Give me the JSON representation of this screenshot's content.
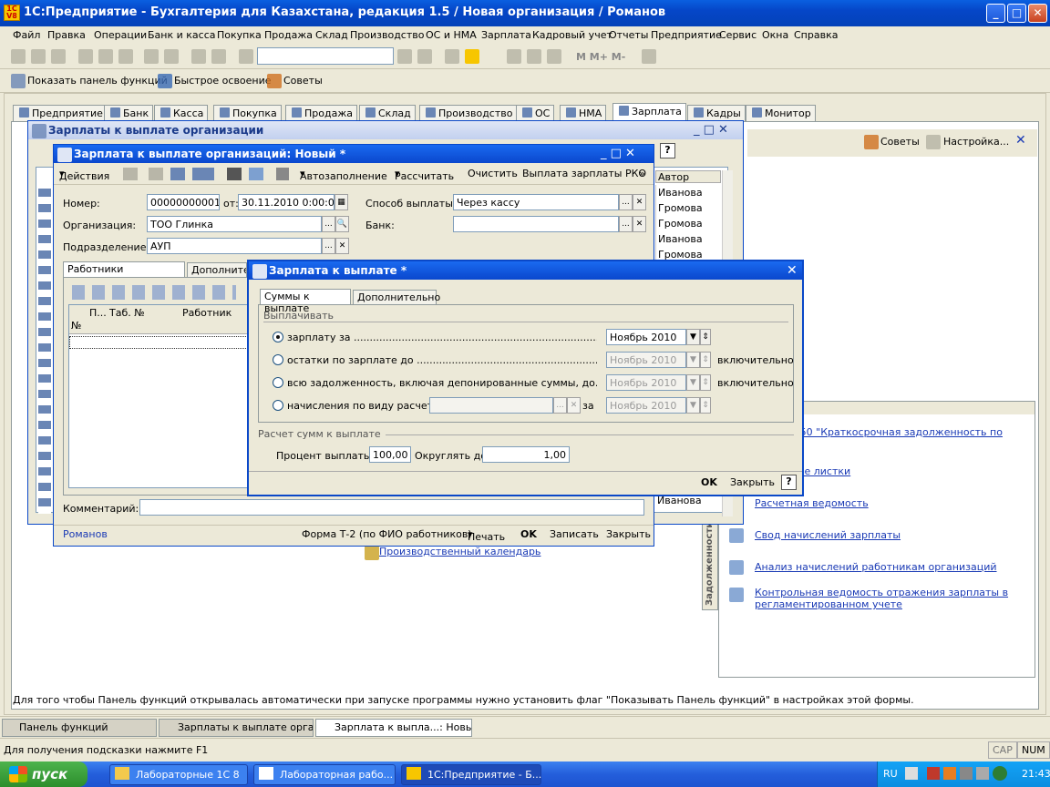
{
  "app": {
    "title": "1С:Предприятие - Бухгалтерия для Казахстана, редакция 1.5 / Новая организация / Романов",
    "logo": "1C V8"
  },
  "menu": [
    "Файл",
    "Правка",
    "Операции",
    "Банк и касса",
    "Покупка",
    "Продажа",
    "Склад",
    "Производство",
    "ОС и НМА",
    "Зарплата",
    "Кадровый учет",
    "Отчеты",
    "Предприятие",
    "Сервис",
    "Окна",
    "Справка"
  ],
  "toolbar2": {
    "show_panel": "Показать панель функций",
    "quick": "Быстрое освоение",
    "tips": "Советы"
  },
  "function_tabs": [
    "Предприятие",
    "Банк",
    "Касса",
    "Покупка",
    "Продажа",
    "Склад",
    "Производство",
    "ОС",
    "НМА",
    "Зарплата",
    "Кадры",
    "Монитор"
  ],
  "panel_right": {
    "tips": "Советы",
    "settings": "Настройка...",
    "side_label": "Задолженности"
  },
  "reports": [
    {
      "label": "...ету 3350 \"Краткосрочная задолженность по ...да\""
    },
    {
      "label": "...е листки"
    },
    {
      "label": "Расчетная ведомость"
    },
    {
      "label": "Свод начислений зарплаты"
    },
    {
      "label": "Анализ начислений работникам организаций"
    },
    {
      "label": "Контрольная ведомость отражения зарплаты в регламентированном учете"
    }
  ],
  "calendar_link": "Производственный календарь",
  "list_window": {
    "title": "Зарплаты к выплате организации",
    "col_author": "Автор",
    "authors": [
      "Иванова",
      "Громова",
      "Громова",
      "Иванова",
      "Громова"
    ],
    "bottom_author": "Иванова"
  },
  "doc_window": {
    "title": "Зарплата к выплате организаций: Новый *",
    "toolbar": {
      "actions": "Действия",
      "autofill": "Автозаполнение",
      "calculate": "Рассчитать",
      "clear": "Очистить",
      "payout": "Выплата зарплаты РКО"
    },
    "number_label": "Номер:",
    "number": "00000000001",
    "date_label": "от:",
    "date": "30.11.2010  0:00:00",
    "org_label": "Организация:",
    "org": "ТОО Глинка",
    "dept_label": "Подразделение:",
    "dept": "АУП",
    "pay_method_label": "Способ выплаты:",
    "pay_method": "Через кассу",
    "bank_label": "Банк:",
    "bank": "",
    "tabs": [
      "Работники организации",
      "Дополнител"
    ],
    "grid_cols": [
      "П...",
      "Таб. №",
      "Работник"
    ],
    "grid_col_n": "№",
    "comment_label": "Комментарий:",
    "comment": "",
    "footer": {
      "user": "Романов",
      "form": "Форма Т-2 (по ФИО работников)",
      "print": "Печать",
      "ok": "OK",
      "save": "Записать",
      "close": "Закрыть"
    }
  },
  "dialog": {
    "title": "Зарплата к выплате *",
    "tabs": [
      "Суммы к выплате",
      "Дополнительно"
    ],
    "group1": "Выплачивать",
    "options": [
      {
        "label": "зарплату за",
        "period": "Ноябрь 2010",
        "suffix": "",
        "selected": true
      },
      {
        "label": "остатки по зарплате до",
        "period": "Ноябрь 2010",
        "suffix": "включительно",
        "selected": false
      },
      {
        "label": "всю задолженность, включая депонированные суммы, до",
        "period": "Ноябрь 2010",
        "suffix": "включительно",
        "selected": false
      },
      {
        "label": "начисления по виду расчета",
        "period": "Ноябрь 2010",
        "suffix": "за",
        "selected": false
      }
    ],
    "group2": "Расчет сумм к выплате",
    "percent_label": "Процент выплаты:",
    "percent": "100,00",
    "round_label": "Округлять до:",
    "round": "1,00",
    "ok": "OK",
    "close": "Закрыть",
    "help": "?"
  },
  "status": {
    "hint": "Для того чтобы Панель функций открывалась автоматически при запуске программы нужно установить флаг \"Показывать Панель функций\" в настройках этой формы.",
    "f1": "Для получения подсказки нажмите F1",
    "cap": "CAP",
    "num": "NUM"
  },
  "window_tabs": [
    "Панель функций",
    "Зарплаты к выплате орган...",
    "Зарплата к выпла...: Новый *"
  ],
  "taskbar": {
    "start": "пуск",
    "items": [
      "Лабораторные 1С 8",
      "Лабораторная рабо...",
      "1С:Предприятие - Б..."
    ],
    "lang": "RU",
    "time": "21:43"
  }
}
